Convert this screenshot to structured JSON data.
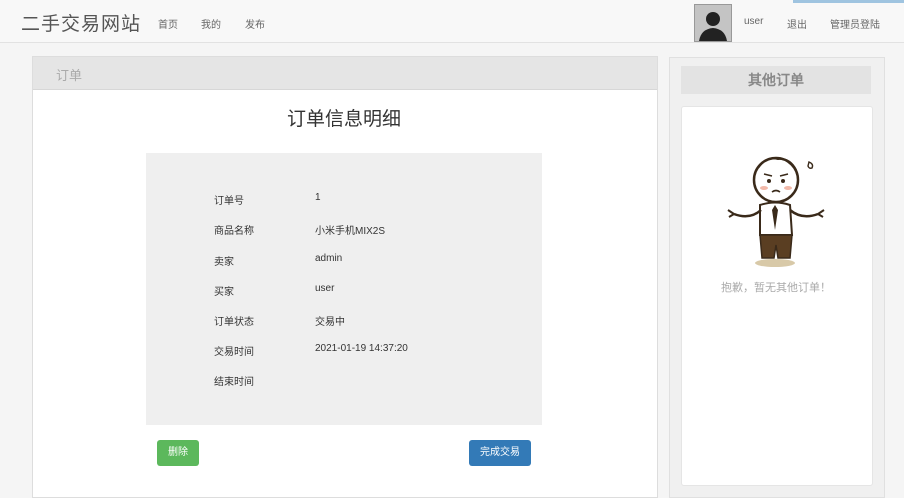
{
  "navbar": {
    "brand": "二手交易网站",
    "links": [
      "首页",
      "我的",
      "发布"
    ],
    "username": "user",
    "logout": "退出",
    "admin_login": "管理员登陆"
  },
  "main": {
    "panel_title": "订单",
    "detail_title": "订单信息明细",
    "rows": [
      {
        "label": "订单号",
        "value": "1"
      },
      {
        "label": "商品名称",
        "value": "小米手机MIX2S"
      },
      {
        "label": "卖家",
        "value": "admin"
      },
      {
        "label": "买家",
        "value": "user"
      },
      {
        "label": "订单状态",
        "value": "交易中"
      },
      {
        "label": "交易时间",
        "value": "2021-01-19 14:37:20"
      },
      {
        "label": "结束时间",
        "value": ""
      }
    ],
    "delete_button": "删除",
    "complete_button": "完成交易"
  },
  "side": {
    "title": "其他订单",
    "empty_text": "抱歉，暂无其他订单！"
  },
  "colors": {
    "success": "#5cb85c",
    "primary": "#337ab7"
  }
}
